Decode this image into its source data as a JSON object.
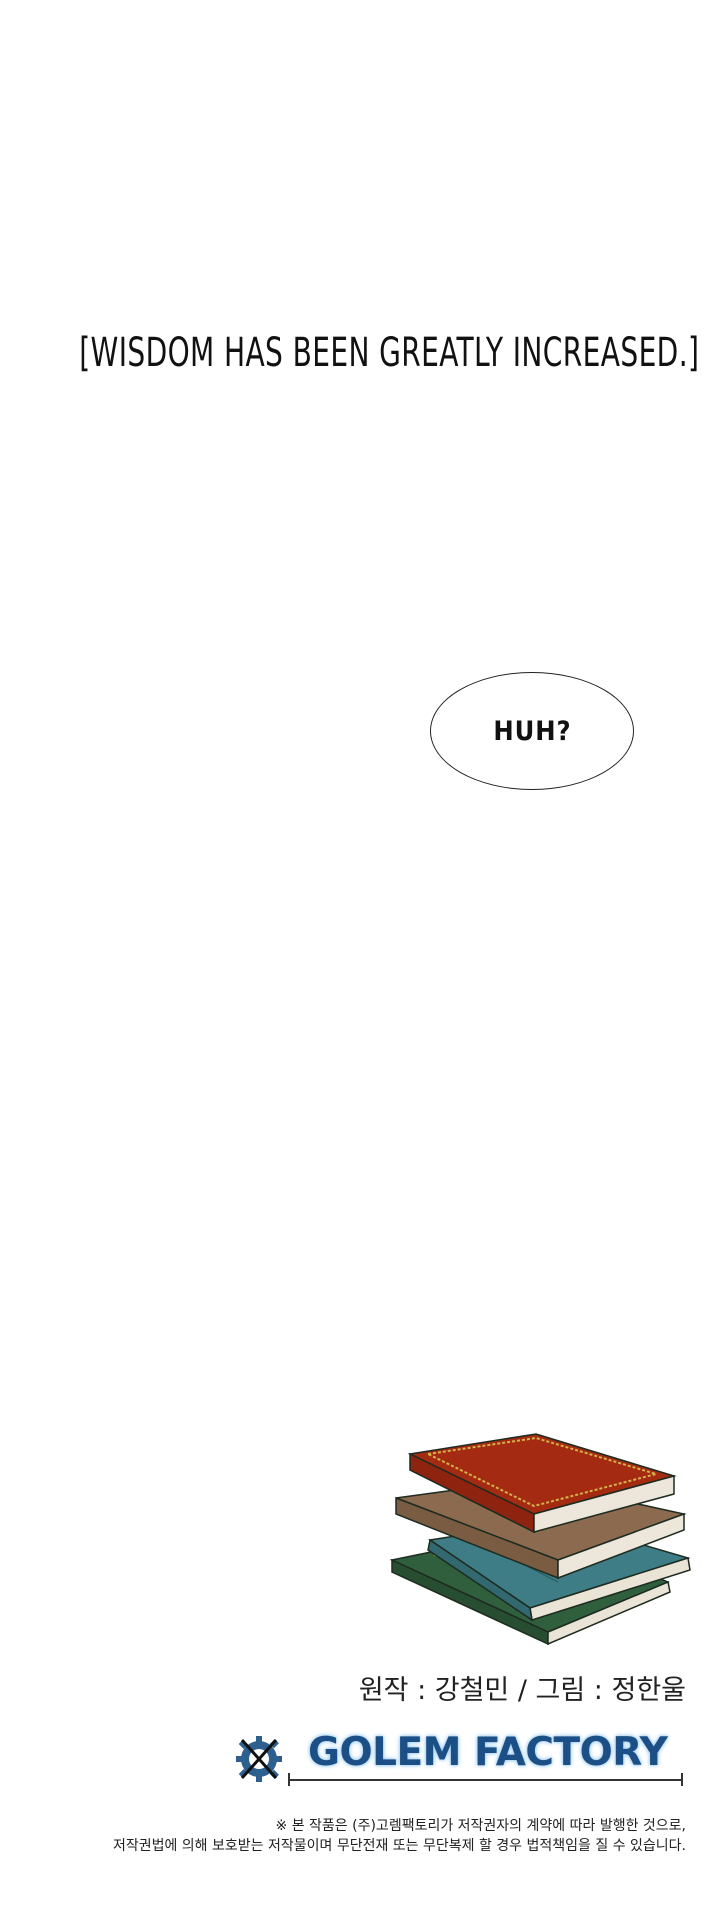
{
  "narration": "[WISDOM HAS BEEN GREATLY INCREASED.]",
  "speech_bubble": "HUH?",
  "credits": "원작 : 강철민 / 그림 : 정한울",
  "logo": {
    "text": "GOLEM FACTORY"
  },
  "notice": {
    "line1": "※ 본 작품은 (주)고렘팩토리가 저작권자의 계약에 따라 발행한 것으로,",
    "line2": "저작권법에 의해 보호받는 저작물이며 무단전재 또는 무단복제 할 경우 법적책임을 질 수 있습니다."
  },
  "colors": {
    "book_red": "#a42a12",
    "book_brown": "#8b6a4f",
    "book_teal": "#3e7c86",
    "book_green": "#2f5f3c",
    "logo_blue": "#1c4f86",
    "gear_blue": "#2d5f8f"
  }
}
